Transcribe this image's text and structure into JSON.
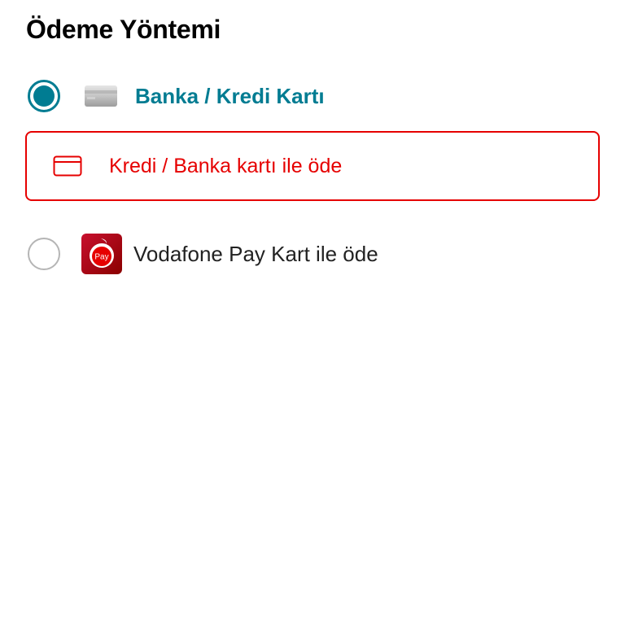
{
  "header": {
    "title": "Ödeme Yöntemi"
  },
  "payment_options": [
    {
      "label": "Banka / Kredi Kartı",
      "selected": true,
      "icon": "credit-card-gray-icon"
    },
    {
      "label": "Vodafone Pay Kart ile öde",
      "selected": false,
      "icon": "vodafone-pay-app-icon",
      "icon_text": "Pay"
    }
  ],
  "card_action": {
    "label": "Kredi / Banka kartı ile öde",
    "icon": "credit-card-outline-icon"
  },
  "colors": {
    "accent_teal": "#007c92",
    "brand_red": "#e60000",
    "text_dark": "#222222",
    "radio_border_unselected": "#b5b5b5"
  }
}
